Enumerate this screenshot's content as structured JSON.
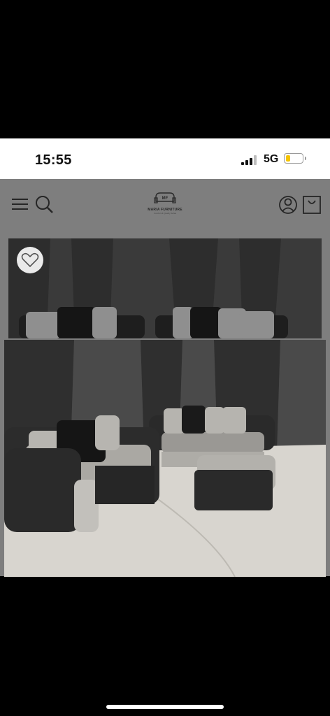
{
  "status_bar": {
    "time": "15:55",
    "network": "5G",
    "signal_bars": 3,
    "battery_level": 0.3,
    "battery_color": "#f5c400"
  },
  "header": {
    "menu_icon": "hamburger-menu-icon",
    "search_icon": "search-icon",
    "account_icon": "account-icon",
    "cart_icon": "shopping-bag-icon",
    "logo": {
      "name": "MARIA FURNITURE",
      "tagline": "Comfort & Quality Sofas",
      "monogram": "MF"
    }
  },
  "product": {
    "wishlist_icon": "heart-icon",
    "image_alt": "Grey and black sofa set with footstool"
  },
  "colors": {
    "overlay_grey": "#7e7e7e",
    "status_bg": "#ffffff"
  }
}
